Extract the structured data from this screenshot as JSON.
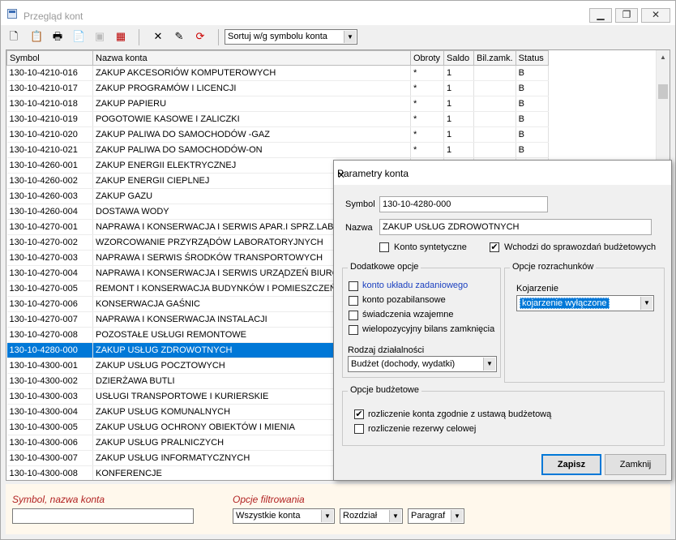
{
  "window": {
    "title": "Przegląd kont",
    "min": "▁",
    "max": "❐",
    "close": "✕"
  },
  "toolbar": {
    "icons": [
      "new-icon",
      "copy-icon",
      "print-icon",
      "preview-icon",
      "disabled-icon",
      "export-icon",
      "delete-icon",
      "edit-icon",
      "refresh-icon"
    ],
    "sort_label": "Sortuj w/g symbolu konta"
  },
  "grid": {
    "headers": [
      "Symbol",
      "Nazwa konta",
      "Obroty",
      "Saldo",
      "Bil.zamk.",
      "Status"
    ],
    "rows": [
      [
        "130-10-4210-016",
        "ZAKUP AKCESORIÓW KOMPUTEROWYCH",
        "*",
        "1",
        "",
        "B"
      ],
      [
        "130-10-4210-017",
        "ZAKUP PROGRAMÓW I LICENCJI",
        "*",
        "1",
        "",
        "B"
      ],
      [
        "130-10-4210-018",
        "ZAKUP PAPIERU",
        "*",
        "1",
        "",
        "B"
      ],
      [
        "130-10-4210-019",
        "POGOTOWIE KASOWE I ZALICZKI",
        "*",
        "1",
        "",
        "B"
      ],
      [
        "130-10-4210-020",
        "ZAKUP PALIWA DO SAMOCHODÓW -GAZ",
        "*",
        "1",
        "",
        "B"
      ],
      [
        "130-10-4210-021",
        "ZAKUP PALIWA DO SAMOCHODÓW-ON",
        "*",
        "1",
        "",
        "B"
      ],
      [
        "130-10-4260-001",
        "ZAKUP ENERGII ELEKTRYCZNEJ",
        "",
        "",
        "",
        ""
      ],
      [
        "130-10-4260-002",
        "ZAKUP ENERGII CIEPLNEJ",
        "",
        "",
        "",
        ""
      ],
      [
        "130-10-4260-003",
        "ZAKUP GAZU",
        "",
        "",
        "",
        ""
      ],
      [
        "130-10-4260-004",
        "DOSTAWA WODY",
        "",
        "",
        "",
        ""
      ],
      [
        "130-10-4270-001",
        "NAPRAWA I KONSERWACJA I SERWIS APAR.I SPRZ.LABOR.",
        "",
        "",
        "",
        ""
      ],
      [
        "130-10-4270-002",
        "WZORCOWANIE PRZYRZĄDÓW LABORATORYJNYCH",
        "",
        "",
        "",
        ""
      ],
      [
        "130-10-4270-003",
        "NAPRAWA I SERWIS ŚRODKÓW TRANSPORTOWYCH",
        "",
        "",
        "",
        ""
      ],
      [
        "130-10-4270-004",
        "NAPRAWA I KONSERWACJA I SERWIS URZĄDZEŃ BIUROWYCH",
        "",
        "",
        "",
        ""
      ],
      [
        "130-10-4270-005",
        "REMONT I KONSERWACJA BUDYNKÓW I POMIESZCZEŃ",
        "",
        "",
        "",
        ""
      ],
      [
        "130-10-4270-006",
        "KONSERWACJA GAŚNIC",
        "",
        "",
        "",
        ""
      ],
      [
        "130-10-4270-007",
        "NAPRAWA I KONSERWACJA INSTALACJI",
        "",
        "",
        "",
        ""
      ],
      [
        "130-10-4270-008",
        "POZOSTAŁE USŁUGI REMONTOWE",
        "",
        "",
        "",
        ""
      ],
      [
        "130-10-4280-000",
        "ZAKUP USŁUG ZDROWOTNYCH",
        "",
        "",
        "",
        ""
      ],
      [
        "130-10-4300-001",
        "ZAKUP USŁUG POCZTOWYCH",
        "",
        "",
        "",
        ""
      ],
      [
        "130-10-4300-002",
        "DZIERŻAWA BUTLI",
        "",
        "",
        "",
        ""
      ],
      [
        "130-10-4300-003",
        "USŁUGI TRANSPORTOWE I KURIERSKIE",
        "",
        "",
        "",
        ""
      ],
      [
        "130-10-4300-004",
        "ZAKUP USŁUG KOMUNALNYCH",
        "",
        "",
        "",
        ""
      ],
      [
        "130-10-4300-005",
        "ZAKUP USŁUG OCHRONY OBIEKTÓW I MIENIA",
        "",
        "",
        "",
        ""
      ],
      [
        "130-10-4300-006",
        "ZAKUP USŁUG PRALNICZYCH",
        "",
        "",
        "",
        ""
      ],
      [
        "130-10-4300-007",
        "ZAKUP USŁUG INFORMATYCZNYCH",
        "",
        "",
        "",
        ""
      ],
      [
        "130-10-4300-008",
        "KONFERENCJE",
        "",
        "",
        "",
        ""
      ]
    ],
    "selected_row": 18
  },
  "filter": {
    "symbol_label": "Symbol, nazwa konta",
    "symbol_value": "",
    "options_label": "Opcje filtrowania",
    "accounts": "Wszystkie konta",
    "section": "Rozdział",
    "paragraph": "Paragraf"
  },
  "dialog": {
    "title": "Parametry konta",
    "symbol_label": "Symbol",
    "symbol_value": "130-10-4280-000",
    "name_label": "Nazwa",
    "name_value": "ZAKUP USŁUG ZDROWOTNYCH",
    "synthetic_label": "Konto syntetyczne",
    "synthetic_checked": false,
    "budget_report_label": "Wchodzi do sprawozdań budżetowych",
    "budget_report_checked": true,
    "extra": {
      "title": "Dodatkowe opcje",
      "items": [
        {
          "label": "konto układu zadaniowego",
          "checked": false,
          "link": true
        },
        {
          "label": "konto pozabilansowe",
          "checked": false,
          "link": false
        },
        {
          "label": "świadczenia wzajemne",
          "checked": false,
          "link": false
        },
        {
          "label": "wielopozycyjny bilans zamknięcia",
          "checked": false,
          "link": false
        }
      ],
      "activity_label": "Rodzaj działalności",
      "activity_value": "Budżet (dochody, wydatki)"
    },
    "settlement": {
      "title": "Opcje rozrachunków",
      "matching_label": "Kojarzenie",
      "matching_value": "kojarzenie wyłączone"
    },
    "budget": {
      "title": "Opcje budżetowe",
      "items": [
        {
          "label": "rozliczenie konta zgodnie z ustawą budżetową",
          "checked": true
        },
        {
          "label": "rozliczenie rezerwy celowej",
          "checked": false
        }
      ]
    },
    "save": "Zapisz",
    "close": "Zamknij"
  }
}
